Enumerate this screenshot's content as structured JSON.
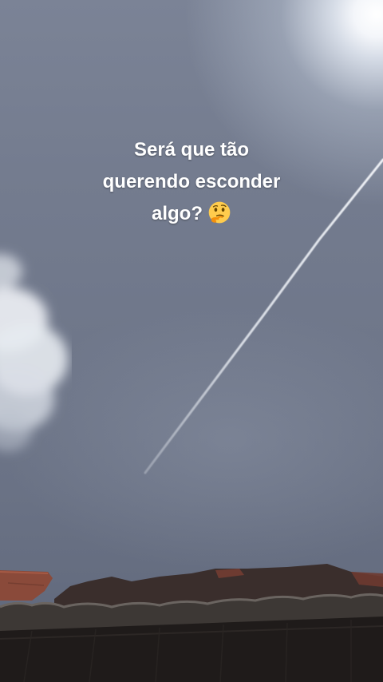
{
  "caption": {
    "line1": "Será que tão",
    "line2": "querendo esconder",
    "line3": "algo?"
  },
  "icons": {
    "caption_emoji": "thinking-face-icon"
  },
  "colors": {
    "sky": "#70788b",
    "caption_text": "#ffffff",
    "roof_dark": "#2a2523",
    "roof_tile": "#7a4a3a"
  }
}
